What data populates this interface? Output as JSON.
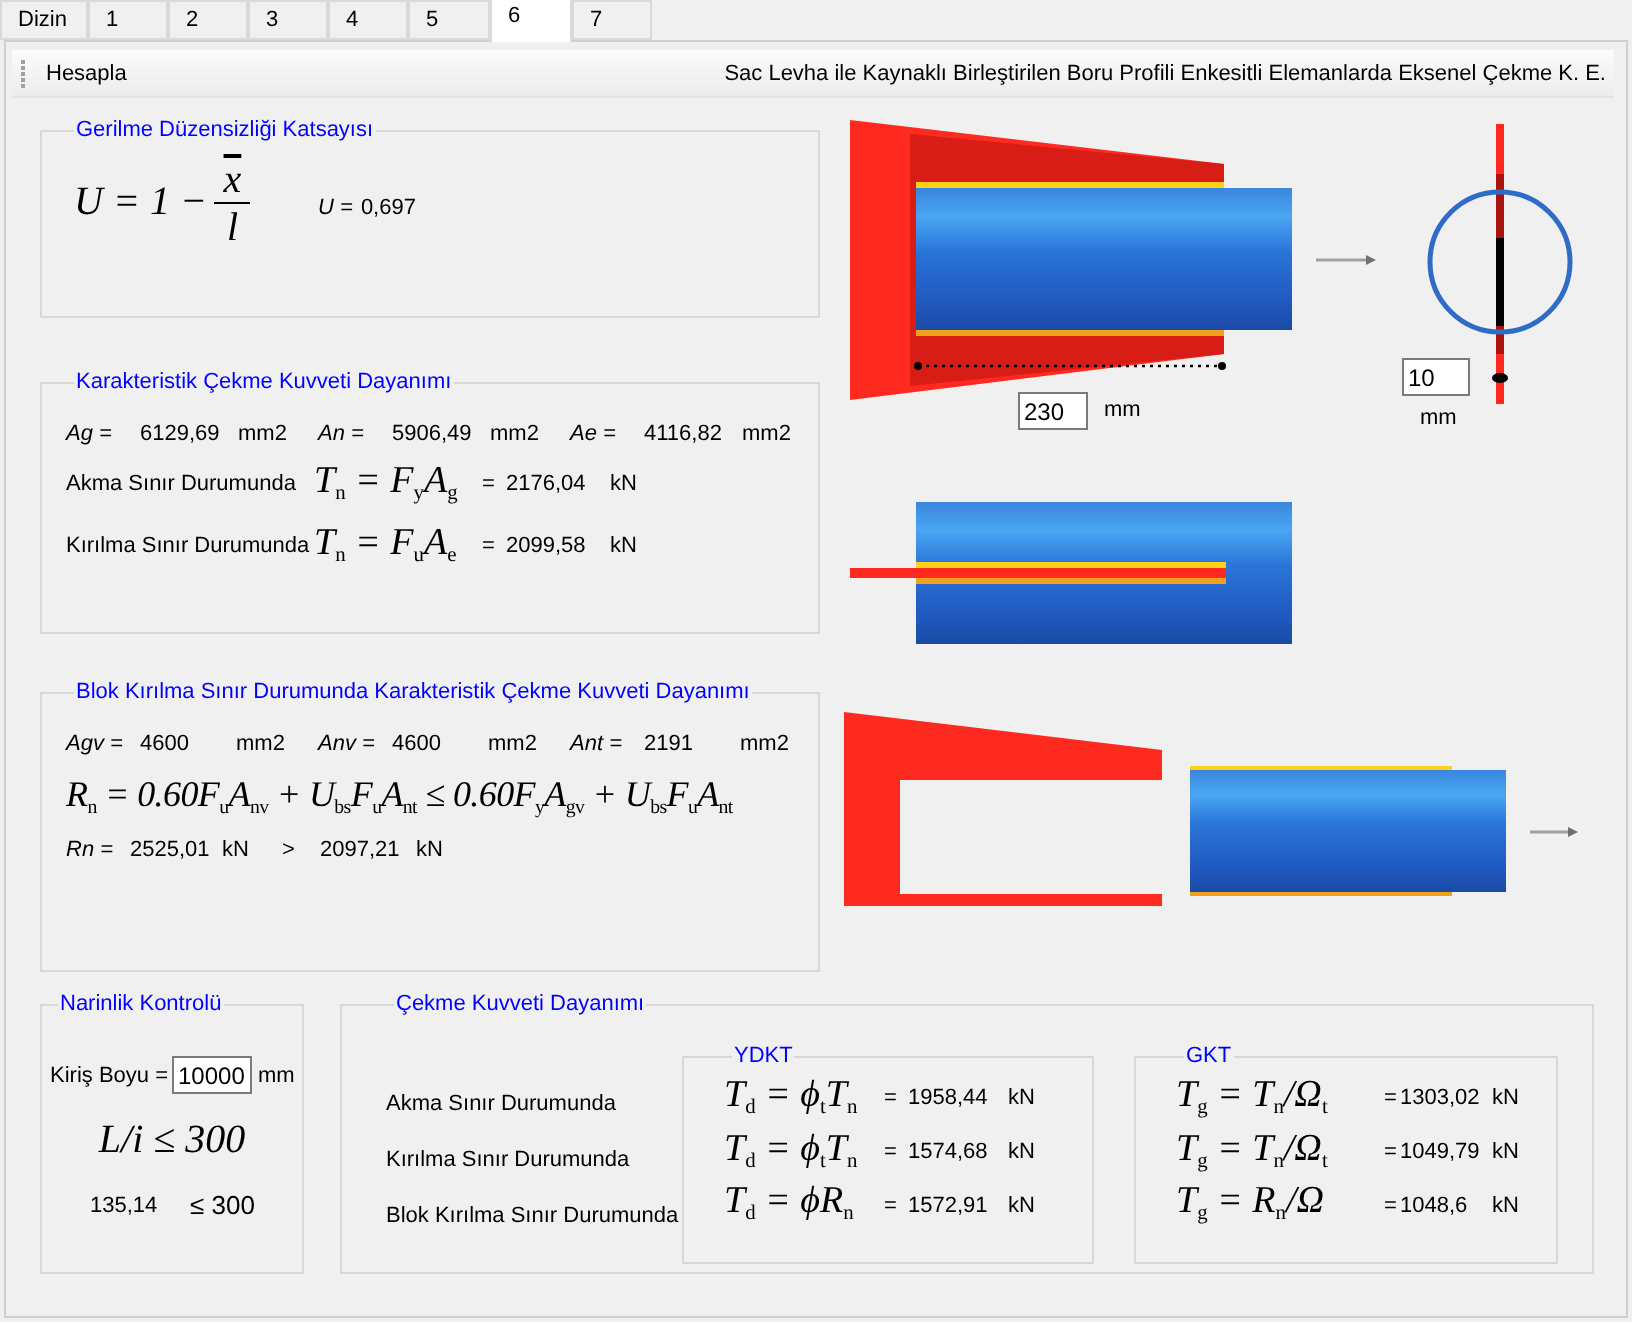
{
  "tabs": [
    {
      "label": "Dizin",
      "selected": false
    },
    {
      "label": "1",
      "selected": false
    },
    {
      "label": "2",
      "selected": false
    },
    {
      "label": "3",
      "selected": false
    },
    {
      "label": "4",
      "selected": false
    },
    {
      "label": "5",
      "selected": false
    },
    {
      "label": "6",
      "selected": true
    },
    {
      "label": "7",
      "selected": false
    }
  ],
  "toolbar": {
    "button": "Hesapla",
    "title": "Sac Levha ile Kaynaklı Birleştirilen Boru Profili Enkesitli Elemanlarda Eksenel Çekme K. E."
  },
  "stress_coefficient": {
    "title": "Gerilme Düzensizliği Katsayısı",
    "formula": {
      "lhs": "U = 1 −",
      "numerator": "x",
      "denominator": "l"
    },
    "result_label": "U =",
    "result_value": "0,697"
  },
  "characteristic": {
    "title": "Karakteristik Çekme Kuvveti Dayanımı",
    "areas": [
      {
        "label": "Ag =",
        "value": "6129,69",
        "unit": "mm2"
      },
      {
        "label": "An =",
        "value": "5906,49",
        "unit": "mm2"
      },
      {
        "label": "Ae =",
        "value": "4116,82",
        "unit": "mm2"
      }
    ],
    "rows": [
      {
        "label": "Akma Sınır Durumunda",
        "formula": "T$_{n}$ = F$_{y}$A$_{g}$",
        "equals": "=",
        "value": "2176,04",
        "unit": "kN"
      },
      {
        "label": "Kırılma Sınır Durumunda",
        "formula": "T$_{n}$ = F$_{u}$A$_{e}$",
        "equals": "=",
        "value": "2099,58",
        "unit": "kN"
      }
    ]
  },
  "block": {
    "title": "Blok Kırılma Sınır Durumunda Karakteristik Çekme Kuvveti Dayanımı",
    "areas": [
      {
        "label": "Agv =",
        "value": "4600",
        "unit": "mm2"
      },
      {
        "label": "Anv =",
        "value": "4600",
        "unit": "mm2"
      },
      {
        "label": "Ant =",
        "value": "2191",
        "unit": "mm2"
      }
    ],
    "formula": "R$_{n}$ = 0.60F$_{u}$A$_{nv}$ + U$_{bs}$F$_{u}$A$_{nt}$ ≤ 0.60F$_{y}$A$_{gv}$ + U$_{bs}$F$_{u}$A$_{nt}$",
    "result": {
      "label": "Rn =",
      "value": "2525,01",
      "unit": "kN",
      "comparator": ">",
      "limit": "2097,21",
      "limit_unit": "kN"
    }
  },
  "slenderness": {
    "title": "Narinlik Kontrolü",
    "length_label": "Kiriş Boyu =",
    "length_value": "10000",
    "length_unit": "mm",
    "formula": "L/i ≤ 300",
    "ratio": "135,14",
    "limit": "≤ 300"
  },
  "tension": {
    "title": "Çekme Kuvveti Dayanımı",
    "row_labels": [
      "Akma Sınır Durumunda",
      "Kırılma Sınır Durumunda",
      "Blok Kırılma Sınır Durumunda"
    ],
    "groups": [
      {
        "title": "YDKT",
        "rows": [
          {
            "formula": "T$_{d}$ = ϕ$_{t}$T$_{n}$",
            "equals": "=",
            "value": "1958,44",
            "unit": "kN"
          },
          {
            "formula": "T$_{d}$ = ϕ$_{t}$T$_{n}$",
            "equals": "=",
            "value": "1574,68",
            "unit": "kN"
          },
          {
            "formula": "T$_{d}$ = ϕR$_{n}$",
            "equals": "=",
            "value": "1572,91",
            "unit": "kN"
          }
        ]
      },
      {
        "title": "GKT",
        "rows": [
          {
            "formula": "T$_{g}$ = T$_{n}$/Ω$_{t}$",
            "equals": "=",
            "value": "1303,02",
            "unit": "kN"
          },
          {
            "formula": "T$_{g}$ = T$_{n}$/Ω$_{t}$",
            "equals": "=",
            "value": "1049,79",
            "unit": "kN"
          },
          {
            "formula": "T$_{g}$ = R$_{n}$/Ω",
            "equals": "=",
            "value": "1048,6",
            "unit": "kN"
          }
        ]
      }
    ]
  },
  "drawings": {
    "weld_length": "230",
    "weld_length_unit": "mm",
    "plate_thickness": "10",
    "plate_thickness_unit": "mm"
  }
}
